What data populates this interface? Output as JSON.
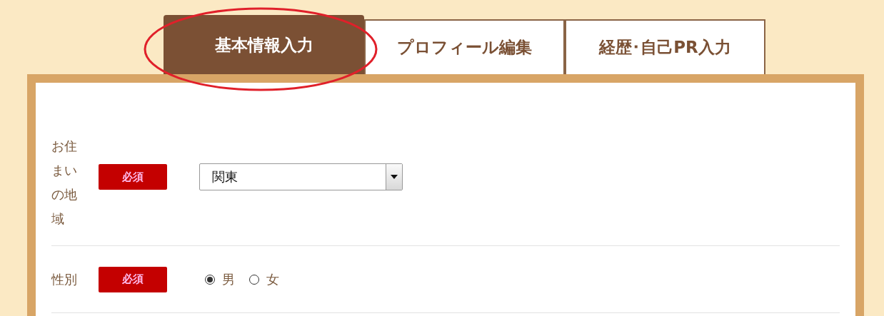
{
  "tabs": [
    {
      "label": "基本情報入力",
      "selected": true,
      "circled": true
    },
    {
      "label": "プロフィール編集",
      "selected": false,
      "circled": false
    },
    {
      "label": "経歴･自己PR入力",
      "selected": false,
      "circled": false
    }
  ],
  "form": {
    "rows": [
      {
        "kind": "select",
        "label": "お住まいの地域",
        "badge": "必須",
        "value": "関東"
      },
      {
        "kind": "radio",
        "label": "性別",
        "badge": "必須",
        "options": [
          {
            "label": "男",
            "selected": true
          },
          {
            "label": "女",
            "selected": false
          }
        ]
      }
    ]
  }
}
